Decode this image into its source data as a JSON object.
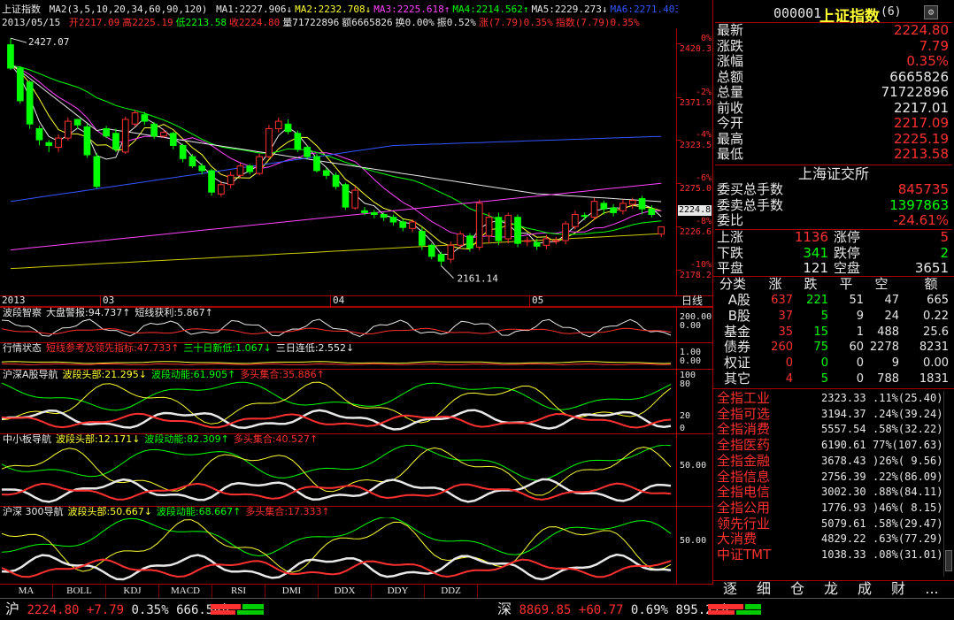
{
  "header": {
    "index_name": "上证指数",
    "ma_params": "MA2(3,5,10,20,34,60,90,120)",
    "ma_values": [
      {
        "label": "MA1:2227.906↓",
        "color": "#e8e8e8"
      },
      {
        "label": "MA2:2232.708↓",
        "color": "#ffff33"
      },
      {
        "label": "MA3:2225.618↑",
        "color": "#ff44ff"
      },
      {
        "label": "MA4:2214.562↑",
        "color": "#00ff00"
      },
      {
        "label": "MA5:2229.273↓",
        "color": "#e8e8e8"
      },
      {
        "label": "MA6:2271.403↓",
        "color": "#3355ff"
      },
      {
        "label": "MA7:2",
        "color": "#ff44ff"
      }
    ],
    "date": "2013/05/15",
    "ohlc": [
      {
        "label": "开2217.09",
        "color": "#ff3030"
      },
      {
        "label": "高2225.19",
        "color": "#ff3030"
      },
      {
        "label": "低2213.58",
        "color": "#00ff00"
      },
      {
        "label": "收2224.80",
        "color": "#ff3030"
      },
      {
        "label": "量71722896",
        "color": "#e8e8e8"
      },
      {
        "label": "额6665826",
        "color": "#e8e8e8"
      },
      {
        "label": "换0.00%",
        "color": "#e8e8e8"
      },
      {
        "label": "振0.52%",
        "color": "#e8e8e8"
      },
      {
        "label": "涨(7.79)0.35%",
        "color": "#ff3030"
      },
      {
        "label": "指数(7.79)0.35%",
        "color": "#ff3030"
      }
    ]
  },
  "main_chart": {
    "high_label": "2427.07",
    "low_label": "2161.14",
    "price_ticks": [
      "2420.3",
      "2371.9",
      "2323.5",
      "2275.0",
      "2226.6",
      "2178.2"
    ],
    "pct_ticks": [
      "0%",
      "-2%",
      "-4%",
      "-6%",
      "-8%",
      "-10%"
    ],
    "current_price_tag": "2224.8",
    "month_labels": [
      "2013",
      "03",
      "04",
      "05"
    ],
    "period_label": "日线"
  },
  "chart_data": {
    "type": "candlestick",
    "title": "上证指数",
    "ylim": [
      2161.14,
      2427.07
    ],
    "open": [
      2420,
      2395,
      2380,
      2330,
      2315,
      2310,
      2320,
      2340,
      2332,
      2300,
      2330,
      2325,
      2305,
      2335,
      2345,
      2335,
      2322,
      2325,
      2312,
      2300,
      2290,
      2285,
      2260,
      2270,
      2280,
      2290,
      2282,
      2300,
      2330,
      2335,
      2325,
      2310,
      2300,
      2285,
      2280,
      2270,
      2245,
      2242,
      2240,
      2238,
      2235,
      2230,
      2223,
      2220,
      2205,
      2195,
      2190,
      2205,
      2215,
      2203,
      2215,
      2235,
      2212,
      2235,
      2210,
      2208,
      2205,
      2210,
      2210,
      2225,
      2237,
      2235,
      2250,
      2245,
      2242,
      2249,
      2255,
      2244,
      2217
    ],
    "close": [
      2395,
      2360,
      2335,
      2318,
      2312,
      2320,
      2338,
      2334,
      2302,
      2268,
      2322,
      2308,
      2340,
      2347,
      2338,
      2322,
      2326,
      2312,
      2298,
      2290,
      2285,
      2262,
      2270,
      2280,
      2290,
      2284,
      2300,
      2330,
      2338,
      2327,
      2308,
      2300,
      2285,
      2280,
      2268,
      2246,
      2264,
      2240,
      2238,
      2235,
      2230,
      2224,
      2230,
      2205,
      2193,
      2188,
      2205,
      2217,
      2202,
      2250,
      2235,
      2210,
      2237,
      2207,
      2210,
      2204,
      2212,
      2210,
      2228,
      2238,
      2236,
      2252,
      2244,
      2240,
      2250,
      2253,
      2244,
      2238,
      2224.8
    ],
    "high": [
      2427.07,
      2397,
      2382,
      2333,
      2318,
      2324,
      2342,
      2338,
      2335,
      2304,
      2333,
      2330,
      2343,
      2350,
      2348,
      2337,
      2330,
      2327,
      2314,
      2303,
      2293,
      2287,
      2274,
      2284,
      2293,
      2292,
      2303,
      2334,
      2342,
      2340,
      2328,
      2312,
      2303,
      2288,
      2283,
      2272,
      2268,
      2246,
      2243,
      2240,
      2238,
      2233,
      2233,
      2224,
      2207,
      2198,
      2209,
      2220,
      2218,
      2254,
      2240,
      2240,
      2240,
      2238,
      2214,
      2212,
      2216,
      2214,
      2231,
      2242,
      2240,
      2256,
      2253,
      2249,
      2254,
      2256,
      2258,
      2248,
      2225.19
    ],
    "low": [
      2393,
      2357,
      2330,
      2312,
      2305,
      2305,
      2317,
      2330,
      2299,
      2266,
      2320,
      2305,
      2303,
      2332,
      2334,
      2319,
      2320,
      2308,
      2294,
      2288,
      2281,
      2258,
      2257,
      2266,
      2277,
      2281,
      2280,
      2298,
      2326,
      2324,
      2305,
      2298,
      2283,
      2276,
      2265,
      2243,
      2243,
      2237,
      2234,
      2231,
      2226,
      2220,
      2219,
      2200,
      2190,
      2183,
      2186,
      2201,
      2198,
      2200,
      2207,
      2205,
      2207,
      2203,
      2204,
      2200,
      2201,
      2206,
      2206,
      2222,
      2232,
      2232,
      2238,
      2236,
      2238,
      2244,
      2238,
      2235,
      2213.58
    ]
  },
  "indicator_panels": [
    {
      "items": [
        {
          "label": "波段智察",
          "color": "#e8e8e8"
        },
        {
          "label": "大盘警报:94.737↑",
          "color": "#e8e8e8"
        },
        {
          "label": "短线获利:5.867↑",
          "color": "#e8e8e8"
        }
      ],
      "ticks": [
        "200.00",
        "0.00"
      ]
    },
    {
      "items": [
        {
          "label": "行情状态",
          "color": "#e8e8e8"
        },
        {
          "label": "短线参考及领先指标:47.733↑",
          "color": "#ff3030"
        },
        {
          "label": "三十日新低:1.067↓",
          "color": "#00ff00"
        },
        {
          "label": "三日连低:2.552↓",
          "color": "#e8e8e8"
        }
      ],
      "ticks": [
        "1.00",
        "0.00"
      ]
    },
    {
      "items": [
        {
          "label": "沪深A股导航",
          "color": "#e8e8e8"
        },
        {
          "label": "波段头部:21.295↓",
          "color": "#ffff33"
        },
        {
          "label": "波段动能:61.905↑",
          "color": "#00ff00"
        },
        {
          "label": "多头集合:35.886↑",
          "color": "#ff3030"
        }
      ],
      "ticks": [
        "100",
        "80",
        "20",
        "0"
      ]
    },
    {
      "items": [
        {
          "label": "中小板导航",
          "color": "#e8e8e8"
        },
        {
          "label": "波段头部:12.171↓",
          "color": "#ffff33"
        },
        {
          "label": "波段动能:82.309↑",
          "color": "#00ff00"
        },
        {
          "label": "多头集合:40.527↑",
          "color": "#ff3030"
        }
      ],
      "ticks": [
        "50.00"
      ]
    },
    {
      "items": [
        {
          "label": "沪深 300导航",
          "color": "#e8e8e8"
        },
        {
          "label": "波段头部:50.667↓",
          "color": "#ffff33"
        },
        {
          "label": "波段动能:68.667↑",
          "color": "#00ff00"
        },
        {
          "label": "多头集合:17.333↑",
          "color": "#ff3030"
        }
      ],
      "ticks": [
        "50.00"
      ]
    }
  ],
  "bottom_tabs": [
    "MA",
    "BOLL",
    "KDJ",
    "MACD",
    "RSI",
    "DMI",
    "DDX",
    "DDY",
    "DDZ"
  ],
  "quote": {
    "code": "000001",
    "name": "上证指数",
    "suffix": "(6)",
    "rows": [
      {
        "label": "最新",
        "value": "2224.80",
        "color": "#ff3030"
      },
      {
        "label": "涨跌",
        "value": "7.79",
        "color": "#ff3030"
      },
      {
        "label": "涨幅",
        "value": "0.35%",
        "color": "#ff3030"
      },
      {
        "label": "总额",
        "value": "6665826",
        "color": "#e8e8e8"
      },
      {
        "label": "总量",
        "value": "71722896",
        "color": "#e8e8e8"
      },
      {
        "label": "前收",
        "value": "2217.01",
        "color": "#e8e8e8"
      },
      {
        "label": "今开",
        "value": "2217.09",
        "color": "#ff3030"
      },
      {
        "label": "最高",
        "value": "2225.19",
        "color": "#ff3030"
      },
      {
        "label": "最低",
        "value": "2213.58",
        "color": "#ff3030"
      }
    ]
  },
  "exchange": {
    "title": "上海证交所",
    "rows": [
      {
        "label": "委买总手数",
        "value": "845735",
        "color": "#ff3030"
      },
      {
        "label": "委卖总手数",
        "value": "1397863",
        "color": "#00ff00"
      },
      {
        "label": "委比",
        "value": "-24.61%",
        "color": "#ff3030"
      }
    ],
    "breadth": [
      {
        "l1": "上涨",
        "v1": "1136",
        "c1": "#ff3030",
        "l2": "涨停",
        "v2": "5",
        "c2": "#ff3030"
      },
      {
        "l1": "下跌",
        "v1": "341",
        "c1": "#00ff00",
        "l2": "跌停",
        "v2": "2",
        "c2": "#00ff00"
      },
      {
        "l1": "平盘",
        "v1": "121",
        "c1": "#e8e8e8",
        "l2": "空盘",
        "v2": "3651",
        "c2": "#e8e8e8"
      }
    ]
  },
  "category_table": {
    "headers": [
      "分类",
      "涨",
      "跌",
      "平",
      "空",
      "额"
    ],
    "rows": [
      [
        "A股",
        "637",
        "221",
        "51",
        "47",
        "665"
      ],
      [
        "B股",
        "37",
        "5",
        "9",
        "24",
        "0.22"
      ],
      [
        "基金",
        "35",
        "15",
        "1",
        "488",
        "25.6"
      ],
      [
        "债券",
        "260",
        "75",
        "60",
        "2278",
        "8231"
      ],
      [
        "权证",
        "0",
        "0",
        "0",
        "9",
        "0.00"
      ],
      [
        "其它",
        "4",
        "5",
        "0",
        "788",
        "1831"
      ]
    ]
  },
  "sector_list": [
    {
      "name": "全指工业",
      "value": "2323.33",
      ".pct": "",
      "chg": ".11%(25.40)"
    },
    {
      "name": "全指可选",
      "value": "3194.37",
      "chg": ".24%(39.24)"
    },
    {
      "name": "全指消费",
      "value": "5557.54",
      "chg": ".58%(32.22)"
    },
    {
      "name": "全指医药",
      "value": "6190.61",
      "chg": "77%(107.63)"
    },
    {
      "name": "全指金融",
      "value": "3678.43",
      "chg": ")26%( 9.56)"
    },
    {
      "name": "全指信息",
      "value": "2756.39",
      "chg": ".22%(86.09)"
    },
    {
      "name": "全指电信",
      "value": "3002.30",
      "chg": ".88%(84.11)"
    },
    {
      "name": "全指公用",
      "value": "1776.93",
      "chg": ")46%( 8.15)"
    },
    {
      "name": "领先行业",
      "value": "5079.61",
      "chg": ".58%(29.47)"
    },
    {
      "name": "大消费",
      "value": "4829.22",
      "chg": ".63%(77.29)"
    },
    {
      "name": "中证TMT",
      "value": "1038.33",
      "chg": ".08%(31.01)"
    }
  ],
  "right_tabs": [
    "逐",
    "细",
    "仓",
    "龙",
    "成",
    "财",
    "..."
  ],
  "status_bar": {
    "sh_label": "沪",
    "sh_price": "2224.80",
    "sh_change": "+7.79",
    "sh_pct": "0.35%",
    "sh_amount": "666.58亿",
    "sz_label": "深",
    "sz_price": "8869.85",
    "sz_change": "+60.77",
    "sz_pct": "0.69%",
    "sz_amount": "895.21亿"
  }
}
